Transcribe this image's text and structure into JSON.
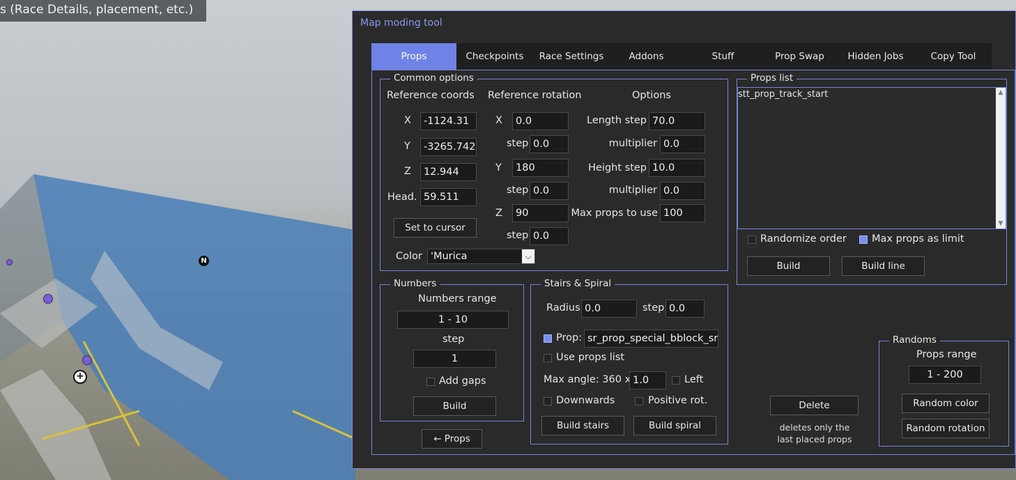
{
  "background": {
    "top_bar_text": "s (Race Details, placement, etc.)",
    "north_marker": "N"
  },
  "window": {
    "title": "Map moding tool",
    "tabs": [
      "Props",
      "Checkpoints",
      "Race Settings",
      "Addons",
      "Stuff",
      "Prop Swap",
      "Hidden Jobs",
      "Copy Tool"
    ],
    "active_tab": "Props"
  },
  "common_options": {
    "title": "Common options",
    "ref_coords_heading": "Reference coords",
    "ref_rotation_heading": "Reference rotation",
    "options_heading": "Options",
    "coords": {
      "x_label": "X",
      "x": "-1124.31",
      "y_label": "Y",
      "y": "-3265.742",
      "z_label": "Z",
      "z": "12.944",
      "head_label": "Head.",
      "head": "59.511"
    },
    "set_to_cursor": "Set to cursor",
    "color_label": "Color",
    "color_value": "'Murica",
    "rotation": {
      "x_label": "X",
      "x": "0.0",
      "x_step_label": "step",
      "x_step": "0.0",
      "y_label": "Y",
      "y": "180",
      "y_step_label": "step",
      "y_step": "0.0",
      "z_label": "Z",
      "z": "90",
      "z_step_label": "step",
      "z_step": "0.0"
    },
    "options": {
      "length_step_label": "Length step",
      "length_step": "70.0",
      "length_mult_label": "multiplier",
      "length_mult": "0.0",
      "height_step_label": "Height step",
      "height_step": "10.0",
      "height_mult_label": "multiplier",
      "height_mult": "0.0",
      "max_props_label": "Max props to use",
      "max_props": "100"
    }
  },
  "props_list": {
    "title": "Props list",
    "items": [
      "stt_prop_track_start"
    ],
    "randomize_order_label": "Randomize order",
    "randomize_order": false,
    "max_props_limit_label": "Max props as limit",
    "max_props_limit": true,
    "build": "Build",
    "build_line": "Build line"
  },
  "numbers": {
    "title": "Numbers",
    "range_label": "Numbers range",
    "range_value": "1  -  10",
    "step_label": "step",
    "step_value": "1",
    "add_gaps_label": "Add gaps",
    "add_gaps": false,
    "build": "Build"
  },
  "back_button": "← Props",
  "stairs": {
    "title": "Stairs & Spiral",
    "radius_label": "Radius",
    "radius": "0.0",
    "step_label": "step",
    "step": "0.0",
    "prop_label": "Prop:",
    "prop_checked": true,
    "prop_value": "sr_prop_special_bblock_sr",
    "use_props_list_label": "Use props list",
    "use_props_list": false,
    "max_angle_label": "Max angle: 360 x",
    "max_angle": "1.0",
    "left_label": "Left",
    "left": false,
    "downwards_label": "Downwards",
    "downwards": false,
    "positive_rot_label": "Positive rot.",
    "positive_rot": false,
    "build_stairs": "Build stairs",
    "build_spiral": "Build spiral"
  },
  "delete": {
    "button": "Delete",
    "note_line1": "deletes only the",
    "note_line2": "last placed props"
  },
  "randoms": {
    "title": "Randoms",
    "range_label": "Props range",
    "range_value": "1  -  200",
    "random_color": "Random color",
    "random_rotation": "Random rotation"
  },
  "colors": {
    "accent": "#6f82e6",
    "border": "#7585d8",
    "panel_bg": "#2a2a2a",
    "title_color": "#8a98ea"
  }
}
